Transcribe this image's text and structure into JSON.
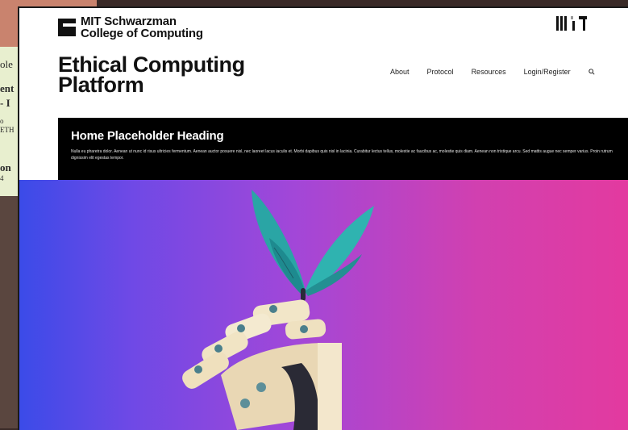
{
  "background_window": {
    "lines": [
      "ole",
      "ent",
      "- I",
      "o",
      "ETH",
      "on",
      "4"
    ]
  },
  "brand": {
    "logo_line1": "MIT Schwarzman",
    "logo_line2": "College of Computing",
    "site_title_line1": "Ethical Computing",
    "site_title_line2": "Platform"
  },
  "nav": {
    "items": [
      "About",
      "Protocol",
      "Resources",
      "Login/Register"
    ]
  },
  "hero": {
    "heading": "Home Placeholder Heading",
    "body": "Nulla eu pharetra dolor. Aenean ut nunc id risus ultricies fermentum. Aenean auctor posuere nisl, nec laoreet lacus iaculis et. Morbi dapibus quis nisl in lacinia. Curabitur lectus tellus, molestie ac faucibus ac, molestie quis diam. Aenean non tristique arcu. Sed mattis augue nec semper varius. Proin rutrum dignissim elit egestas tempor."
  },
  "colors": {
    "gradient_left": "#3b4be8",
    "gradient_right": "#e33a9f",
    "butterfly": "#2aa5a5",
    "hand": "#f2e6c8"
  }
}
